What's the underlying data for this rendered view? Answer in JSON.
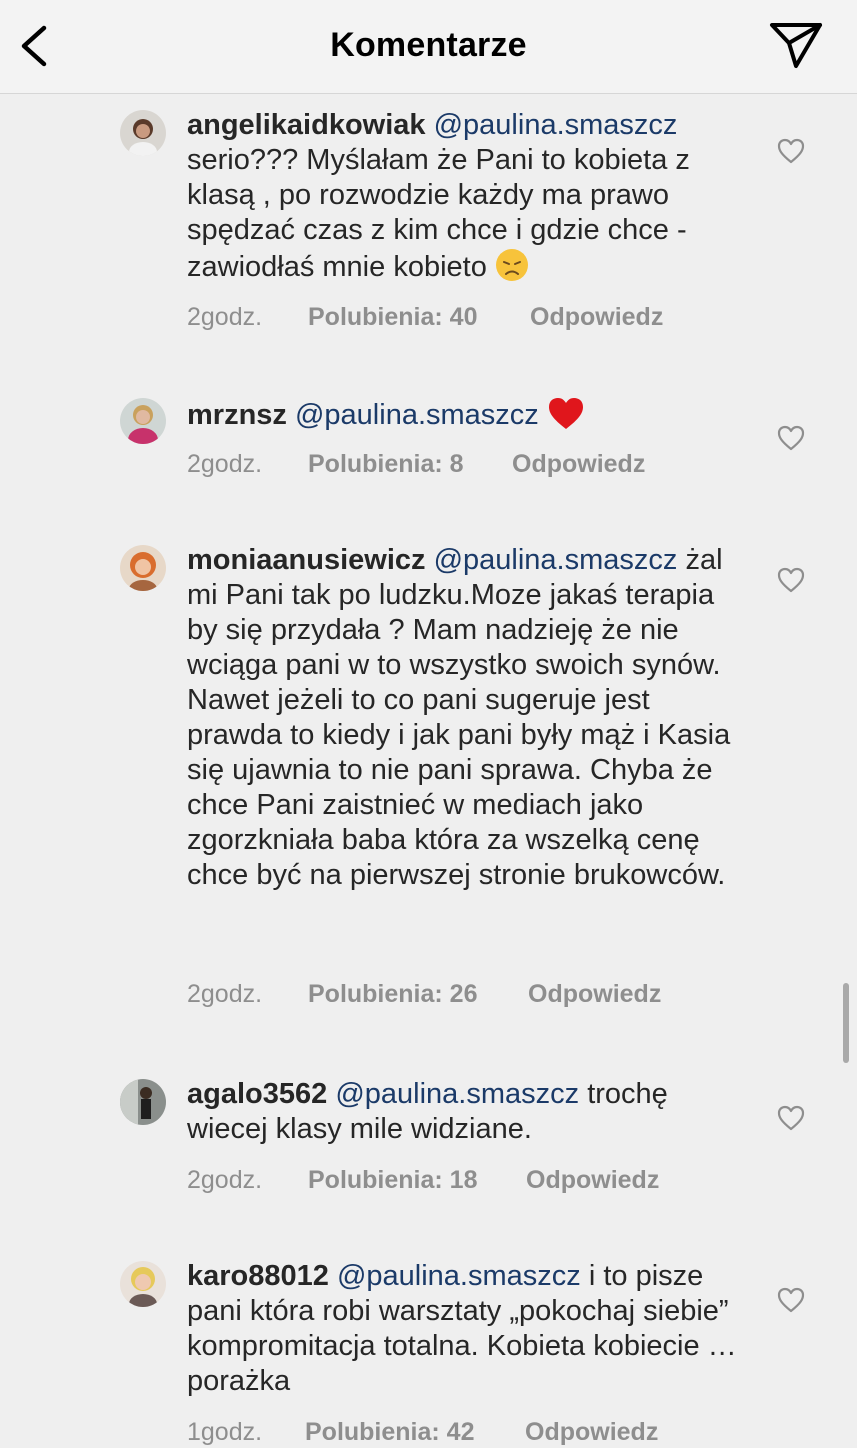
{
  "header": {
    "title": "Komentarze",
    "back_icon": "chevron-left-icon",
    "send_icon": "paper-plane-icon"
  },
  "colors": {
    "mention": "#1b3a68",
    "meta": "#8e8e8e",
    "text": "#262626",
    "background": "#efefef"
  },
  "comments": [
    {
      "username": "angelikaidkowiak",
      "mention": "@paulina.smaszcz",
      "text": " serio??? Myślałam że Pani to kobieta z klasą , po rozwodzie każdy ma prawo spędzać czas z kim chce i gdzie chce - zawiodłaś mnie kobieto ",
      "emoji": "disappointed-face",
      "time": "2godz.",
      "likes": "Polubienia: 40",
      "reply": "Odpowiedz"
    },
    {
      "username": "mrznsz",
      "mention": "@paulina.smaszcz",
      "text": " ",
      "emoji": "red-heart",
      "time": "2godz.",
      "likes": "Polubienia: 8",
      "reply": "Odpowiedz"
    },
    {
      "username": "moniaanusiewicz",
      "mention": "@paulina.smaszcz",
      "text": " żal mi Pani tak po ludzku.Moze jakaś terapia by się przydała ? Mam nadzieję że nie wciąga pani w to wszystko swoich synów. Nawet jeżeli to co pani sugeruje jest prawda to kiedy i jak pani były mąż i Kasia się ujawnia to nie pani sprawa. Chyba że chce Pani zaistnieć w mediach jako zgorzkniała baba która za wszelką cenę chce być na pierwszej stronie brukowców.",
      "emoji": "",
      "time": "2godz.",
      "likes": "Polubienia: 26",
      "reply": "Odpowiedz"
    },
    {
      "username": "agalo3562",
      "mention": "@paulina.smaszcz",
      "text": " trochę wiecej klasy mile widziane.",
      "emoji": "",
      "time": "2godz.",
      "likes": "Polubienia: 18",
      "reply": "Odpowiedz"
    },
    {
      "username": "karo88012",
      "mention": "@paulina.smaszcz",
      "text": " i to pisze pani która robi warsztaty „pokochaj siebie” kompromitacja totalna. Kobieta kobiecie … porażka",
      "emoji": "",
      "time": "1godz.",
      "likes": "Polubienia: 42",
      "reply": "Odpowiedz"
    }
  ]
}
